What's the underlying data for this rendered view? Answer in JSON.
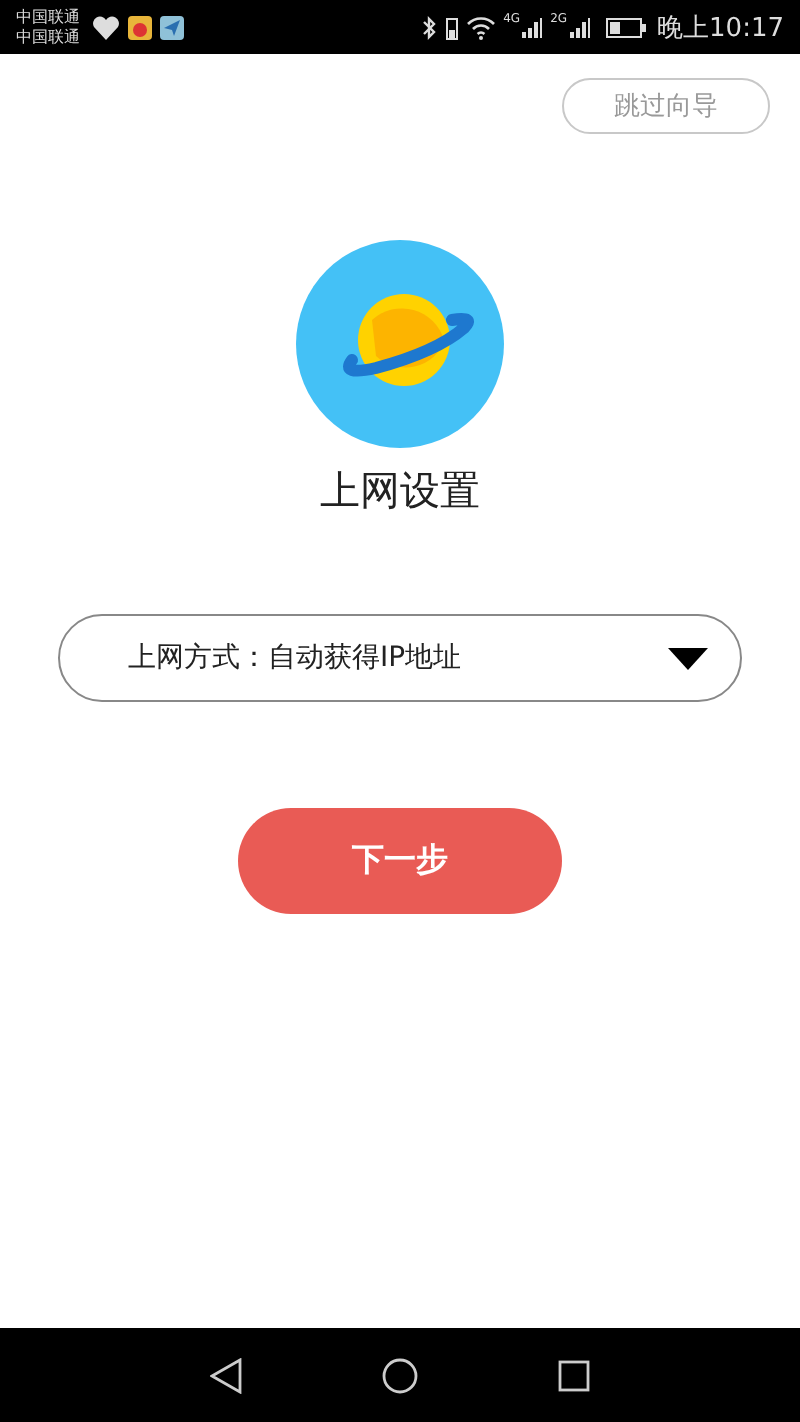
{
  "status_bar": {
    "carriers": [
      "中国联通",
      "中国联通"
    ],
    "network_labels": [
      "4G",
      "2G"
    ],
    "time": "晚上10:17"
  },
  "skip_button": {
    "label": "跳过向导"
  },
  "title": "上网设置",
  "connection_select": {
    "value": "上网方式：自动获得IP地址"
  },
  "next_button": {
    "label": "下一步"
  }
}
